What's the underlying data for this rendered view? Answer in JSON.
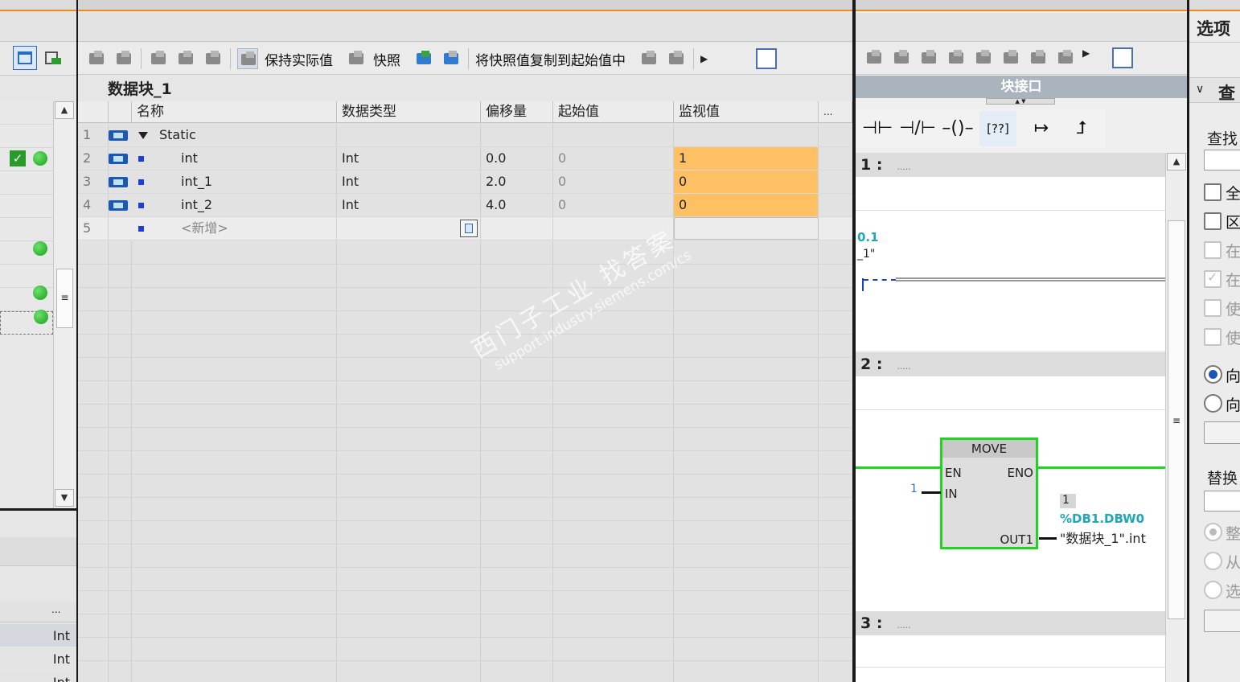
{
  "block": {
    "title": "数据块_1",
    "toolbar": {
      "retain_label": "保持实际值",
      "snapshot_label": "快照",
      "copy_snapshot_label": "将快照值复制到起始值中"
    },
    "columns": {
      "name": "名称",
      "type": "数据类型",
      "offset": "偏移量",
      "start": "起始值",
      "monitor": "监视值",
      "more": "..."
    },
    "rows": [
      {
        "num": "1",
        "name": "Static",
        "type": "",
        "offset": "",
        "start": "",
        "monitor": ""
      },
      {
        "num": "2",
        "name": "int",
        "type": "Int",
        "offset": "0.0",
        "start": "0",
        "monitor": "1"
      },
      {
        "num": "3",
        "name": "int_1",
        "type": "Int",
        "offset": "2.0",
        "start": "0",
        "monitor": "0"
      },
      {
        "num": "4",
        "name": "int_2",
        "type": "Int",
        "offset": "4.0",
        "start": "0",
        "monitor": "0"
      },
      {
        "num": "5",
        "name": "<新增>",
        "type": "",
        "offset": "",
        "start": "",
        "monitor": ""
      }
    ]
  },
  "left_panel": {
    "more": "...",
    "types": [
      "Int",
      "Int",
      "Int"
    ]
  },
  "editor": {
    "interface_label": "块接口",
    "networks": [
      {
        "label": "1 :",
        "comment": "....."
      },
      {
        "label": "2 :",
        "comment": "....."
      },
      {
        "label": "3 :",
        "comment": "....."
      }
    ],
    "net1": {
      "addr": "0.1",
      "name": "_1\""
    },
    "move": {
      "title": "MOVE",
      "en": "EN",
      "eno": "ENO",
      "in": "IN",
      "out": "OUT1",
      "in_value": "1",
      "out_value": "1",
      "out_addr": "%DB1.DBW0",
      "out_tag": "\"数据块_1\".int"
    }
  },
  "options": {
    "title": "选项",
    "find_header": "查",
    "find_label": "查找",
    "checks": [
      "全",
      "区",
      "在",
      "在",
      "使",
      "使"
    ],
    "dirs": [
      "向",
      "向"
    ],
    "replace_label": "替换",
    "replace_opts": [
      "整",
      "从",
      "选"
    ]
  },
  "watermark": {
    "line1": "西门子工业 找答案",
    "line2": "support.industry.siemens.com/cs"
  },
  "colors": {
    "monitor": "#fdc164",
    "accent": "#f08c1e",
    "box_green": "#22d322",
    "tag_cyan": "#1fa7b8"
  }
}
